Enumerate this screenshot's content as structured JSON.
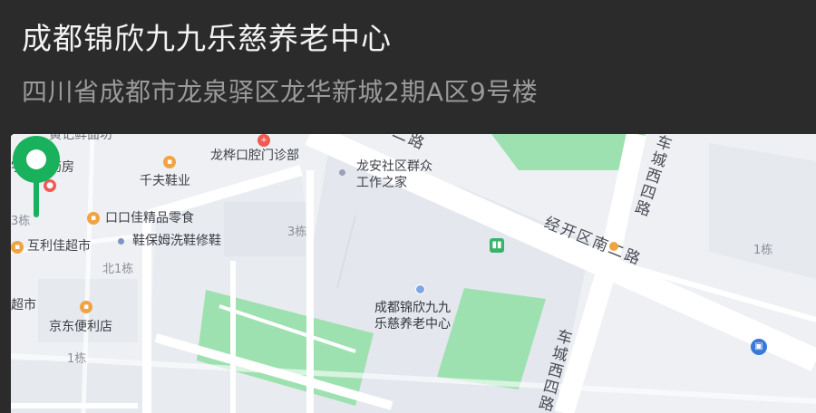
{
  "header": {
    "title": "成都锦欣九九乐慈养老中心",
    "address": "四川省成都市龙泉驿区龙华新城2期A区9号楼"
  },
  "map": {
    "destination_label_line1": "成都锦欣九九",
    "destination_label_line2": "乐慈养老中心",
    "roads": {
      "jingkai_nan2": "经开区南二路",
      "jingkai_nan2_partial": "二路",
      "checheng_west4_upper": "车城西四路",
      "checheng_west4_lower": "车城西四路"
    },
    "pois": [
      {
        "name": "龙桦口腔门诊部",
        "icon": "clinic-icon"
      },
      {
        "name": "龙安社区群众工作之家",
        "line1": "龙安社区群众",
        "line2": "工作之家",
        "icon": "community-icon"
      },
      {
        "name": "宇诚大药房",
        "icon": "pharmacy-icon"
      },
      {
        "name": "千夫鞋业",
        "icon": "shop-icon"
      },
      {
        "name": "口口佳精品零食",
        "icon": "snack-icon"
      },
      {
        "name": "鞋保姆洗鞋修鞋",
        "icon": "dot-icon"
      },
      {
        "name": "互利佳超市",
        "icon": "supermarket-icon"
      },
      {
        "name": "京东便利店",
        "icon": "store-icon"
      },
      {
        "name": "超市",
        "icon": "supermarket-icon"
      },
      {
        "name": "黄记鲜面坊",
        "icon": "food-icon"
      }
    ],
    "buildings": {
      "b3_center": "3栋",
      "b3_left": "3栋",
      "bei1": "北1栋",
      "b1_left": "1栋",
      "b1_right": "1栋"
    },
    "colors": {
      "pin": "#19b15b",
      "park": "#9ee1b0",
      "road": "#ffffff",
      "background": "#eef0f4"
    }
  }
}
